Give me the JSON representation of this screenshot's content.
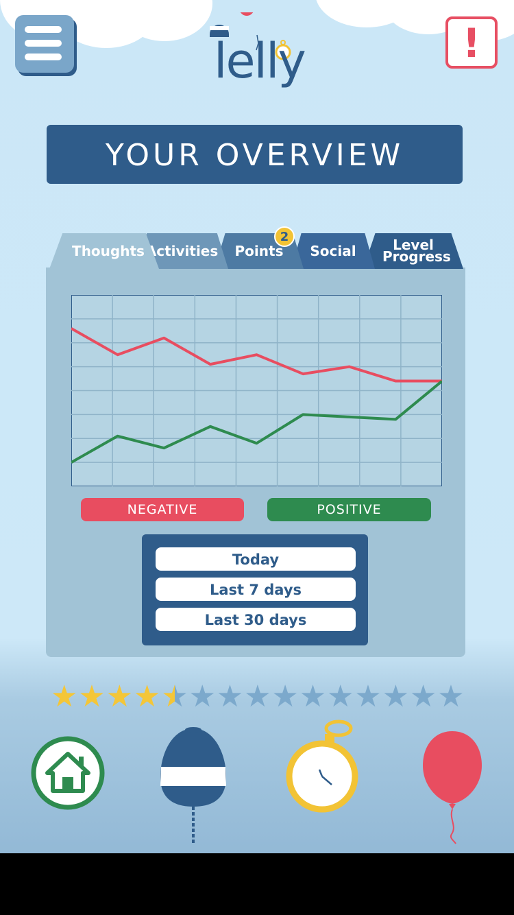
{
  "app": {
    "logo_text": "lelly",
    "menu_icon": "menu-icon",
    "alert_label": "!"
  },
  "overview": {
    "title": "YOUR OVERVIEW"
  },
  "tabs": [
    {
      "label": "Thoughts",
      "active": true
    },
    {
      "label": "Activities",
      "active": false
    },
    {
      "label": "Points",
      "active": false,
      "badge": "2"
    },
    {
      "label": "Social",
      "active": false
    },
    {
      "label": "Level Progress",
      "active": false
    }
  ],
  "chart_data": {
    "type": "line",
    "x": [
      1,
      2,
      3,
      4,
      5,
      6,
      7,
      8,
      9
    ],
    "series": [
      {
        "name": "NEGATIVE",
        "color": "#e84d60",
        "values": [
          6.6,
          5.5,
          6.2,
          5.1,
          5.5,
          4.7,
          5.0,
          4.4,
          null
        ]
      },
      {
        "name": "POSITIVE",
        "color": "#2e8b4f",
        "values": [
          1.0,
          2.1,
          1.6,
          2.5,
          1.8,
          3.0,
          2.9,
          2.8,
          4.4
        ]
      }
    ],
    "ylim": [
      0,
      8
    ],
    "grid": true,
    "xlabel": "",
    "ylabel": ""
  },
  "legend": {
    "negative_label": "NEGATIVE",
    "positive_label": "POSITIVE",
    "negative_color": "#e84d60",
    "positive_color": "#2e8b4f"
  },
  "time_range": {
    "options": [
      "Today",
      "Last 7 days",
      "Last 30 days"
    ]
  },
  "progress": {
    "stars_total": 15,
    "stars_filled": 4.5
  },
  "bottom_nav": [
    {
      "icon": "home-icon"
    },
    {
      "icon": "buoy-icon"
    },
    {
      "icon": "stopwatch-icon"
    },
    {
      "icon": "balloon-icon"
    }
  ]
}
